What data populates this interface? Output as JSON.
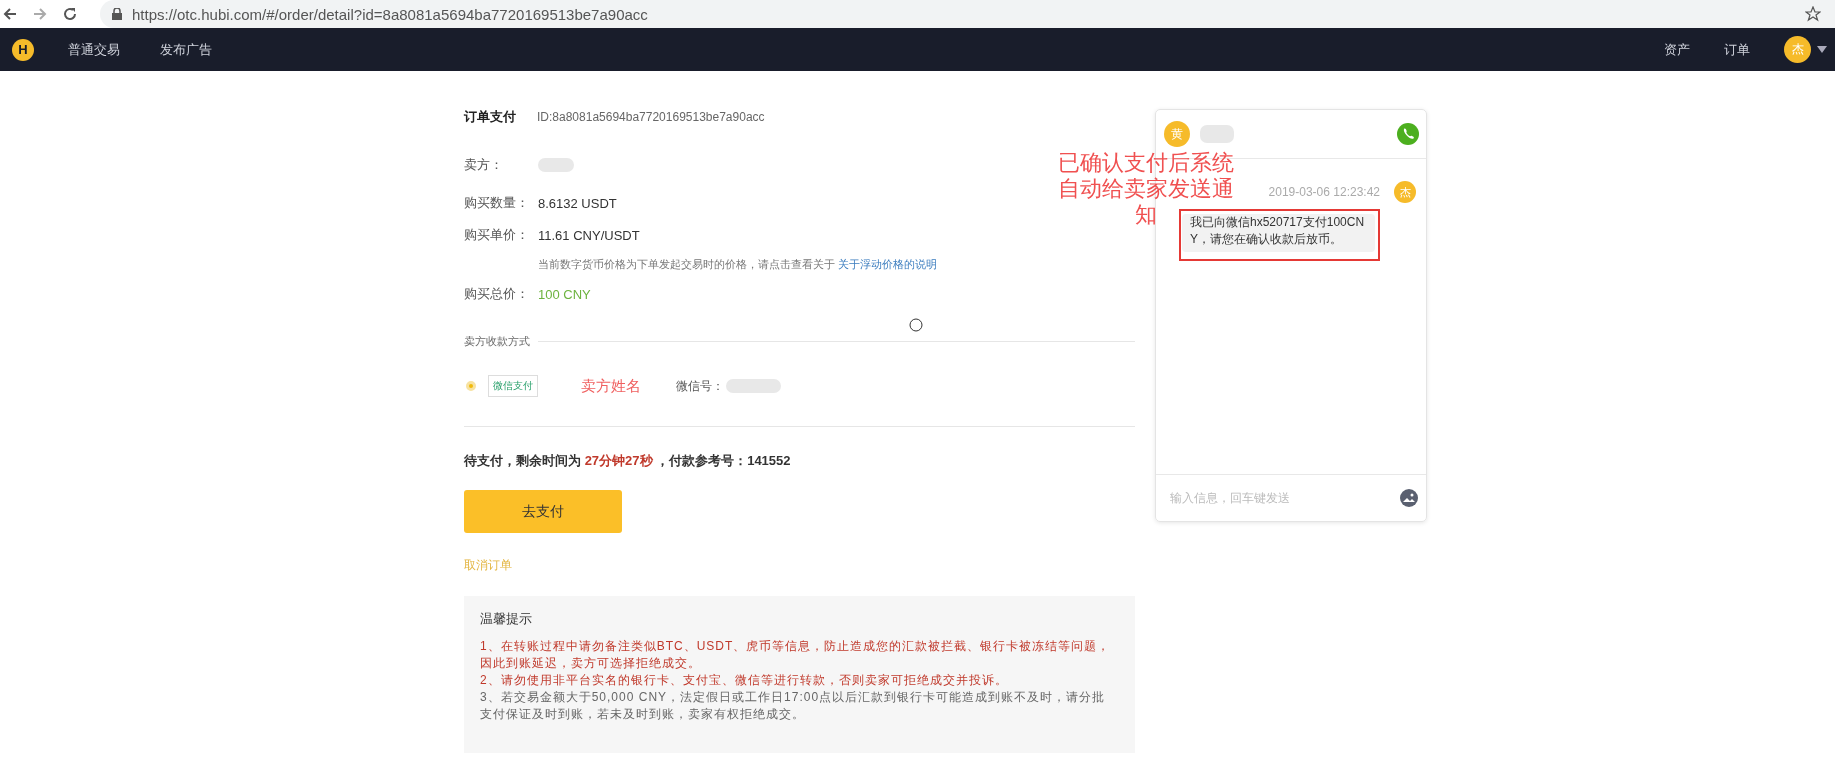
{
  "browser": {
    "url": "https://otc.hubi.com/#/order/detail?id=8a8081a5694ba7720169513be7a90acc"
  },
  "nav": {
    "logo": "H",
    "left_links": [
      {
        "label": "普通交易"
      },
      {
        "label": "发布广告"
      }
    ],
    "right_links": [
      {
        "label": "资产"
      },
      {
        "label": "订单"
      }
    ],
    "avatar": "杰"
  },
  "order": {
    "title": "订单支付",
    "id": "ID:8a8081a5694ba7720169513be7a90acc",
    "fields": [
      {
        "label": "卖方：",
        "redacted": true
      },
      {
        "label": "购买数量：",
        "value": "8.6132 USDT"
      },
      {
        "label": "购买单价：",
        "value": "11.61 CNY/USDT"
      }
    ],
    "price_note": {
      "text": "当前数字货币价格为下单发起交易时的价格，请点击查看关于",
      "link": "关于浮动价格的说明"
    },
    "total": {
      "label": "购买总价：",
      "value": "100 CNY"
    },
    "payment_section": {
      "title": "卖方收款方式",
      "methods": [
        {
          "selected": true,
          "badge": "微信支付",
          "name": "卖方姓名",
          "account_label": "微信号：",
          "account_redacted": true
        }
      ]
    },
    "status": {
      "prefix": "待支付，剩余时间为",
      "time": "27分钟27秒",
      "suffix": "，付款参考号：141552"
    },
    "pay_button": "去支付",
    "cancel_link": "取消订单",
    "tips": {
      "title": "温馨提示",
      "items": [
        {
          "text": "1、在转账过程中请勿备注类似BTC、USDT、虎币等信息，防止造成您的汇款被拦截、银行卡被冻结等问题，因此到账延迟，卖方可选择拒绝成交。",
          "color": "#c0392b"
        },
        {
          "text": "2、请勿使用非平台实名的银行卡、支付宝、微信等进行转款，否则卖家可拒绝成交并投诉。",
          "color": "#c0392b"
        },
        {
          "text": "3、若交易金额大于50,000 CNY，法定假日或工作日17:00点以后汇款到银行卡可能造成到账不及时，请分批支付保证及时到账，若未及时到账，卖家有权拒绝成交。",
          "color": "#666666"
        }
      ]
    }
  },
  "chat": {
    "peer_avatar": "黄",
    "peer_name_redacted": true,
    "messages": [
      {
        "time": "2019-03-06 12:23:42",
        "avatar": "杰",
        "text": "我已向微信hx520717支付100CNY，请您在确认收款后放币。",
        "highlighted": true
      }
    ],
    "input": {
      "placeholder": "输入信息，回车键发送"
    }
  },
  "annotation": {
    "lines": [
      "已确认支付后系统",
      "自动给卖家发送通",
      "知"
    ]
  }
}
